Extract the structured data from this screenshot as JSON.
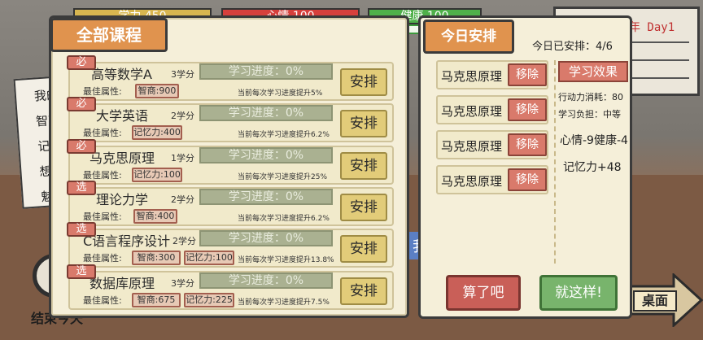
{
  "status_bars": {
    "first_label": "学力 450",
    "mood_label": "心情 100",
    "health_label": "健康 100"
  },
  "board": {
    "title": "第一学年 Day1"
  },
  "background": {
    "paper_lines": [
      "我的",
      "智商",
      "记忆",
      "想象",
      "魅"
    ],
    "end_day": "结束今天",
    "blue_tab": "我",
    "desktop_label": "桌面"
  },
  "all_courses": {
    "title": "全部课程",
    "best_attr_label": "最佳属性:",
    "arrange_label": "安排",
    "courses": [
      {
        "tag": "必",
        "name": "高等数学A",
        "credits": "3学分",
        "progress_text": "学习进度：0%",
        "progress": 0,
        "attrs": [
          "智商:900"
        ],
        "note": "当前每次学习进度提升5%"
      },
      {
        "tag": "必",
        "name": "大学英语",
        "credits": "2学分",
        "progress_text": "学习进度：0%",
        "progress": 0,
        "attrs": [
          "记忆力:400"
        ],
        "note": "当前每次学习进度提升6.2%"
      },
      {
        "tag": "必",
        "name": "马克思原理",
        "credits": "1学分",
        "progress_text": "学习进度：0%",
        "progress": 0,
        "attrs": [
          "记忆力:100"
        ],
        "note": "当前每次学习进度提升25%"
      },
      {
        "tag": "选",
        "name": "理论力学",
        "credits": "2学分",
        "progress_text": "学习进度：0%",
        "progress": 0,
        "attrs": [
          "智商:400"
        ],
        "note": "当前每次学习进度提升6.2%"
      },
      {
        "tag": "选",
        "name": "C语言程序设计",
        "credits": "2学分",
        "progress_text": "学习进度：0%",
        "progress": 0,
        "attrs": [
          "智商:300",
          "记忆力:100"
        ],
        "note": "当前每次学习进度提升13.8%"
      },
      {
        "tag": "选",
        "name": "数据库原理",
        "credits": "3学分",
        "progress_text": "学习进度：0%",
        "progress": 0,
        "attrs": [
          "智商:675",
          "记忆力:225"
        ],
        "note": "当前每次学习进度提升7.5%"
      }
    ]
  },
  "today": {
    "title": "今日安排",
    "count_label": "今日已安排：4/6",
    "remove_label": "移除",
    "items": [
      "马克思原理",
      "马克思原理",
      "马克思原理",
      "马克思原理"
    ],
    "effect_title": "学习效果",
    "energy_cost": "行动力消耗：80",
    "burden": "学习负担：中等",
    "mood_health": "心情-9健康-4",
    "memory_gain": "记忆力+48",
    "cancel_label": "算了吧",
    "confirm_label": "就这样!"
  },
  "colors": {
    "accent_orange": "#e0934e",
    "remove_red": "#d97a6b",
    "arrange_yellow": "#e2cc79",
    "confirm_green": "#78b46c"
  }
}
